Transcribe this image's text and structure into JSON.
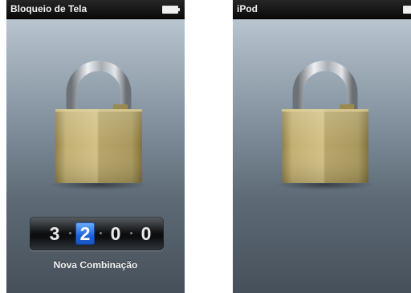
{
  "left_screen": {
    "title": "Bloqueio de Tela",
    "battery_icon": "battery-icon",
    "lock_icon": "padlock-icon",
    "combination": {
      "digits": [
        "3",
        "2",
        "0",
        "0"
      ],
      "selected_index": 1,
      "selected_color": "#1d62d9"
    },
    "combination_label": "Nova Combinação"
  },
  "right_screen": {
    "title": "iPod",
    "battery_icon": "battery-icon",
    "lock_icon": "padlock-icon"
  }
}
